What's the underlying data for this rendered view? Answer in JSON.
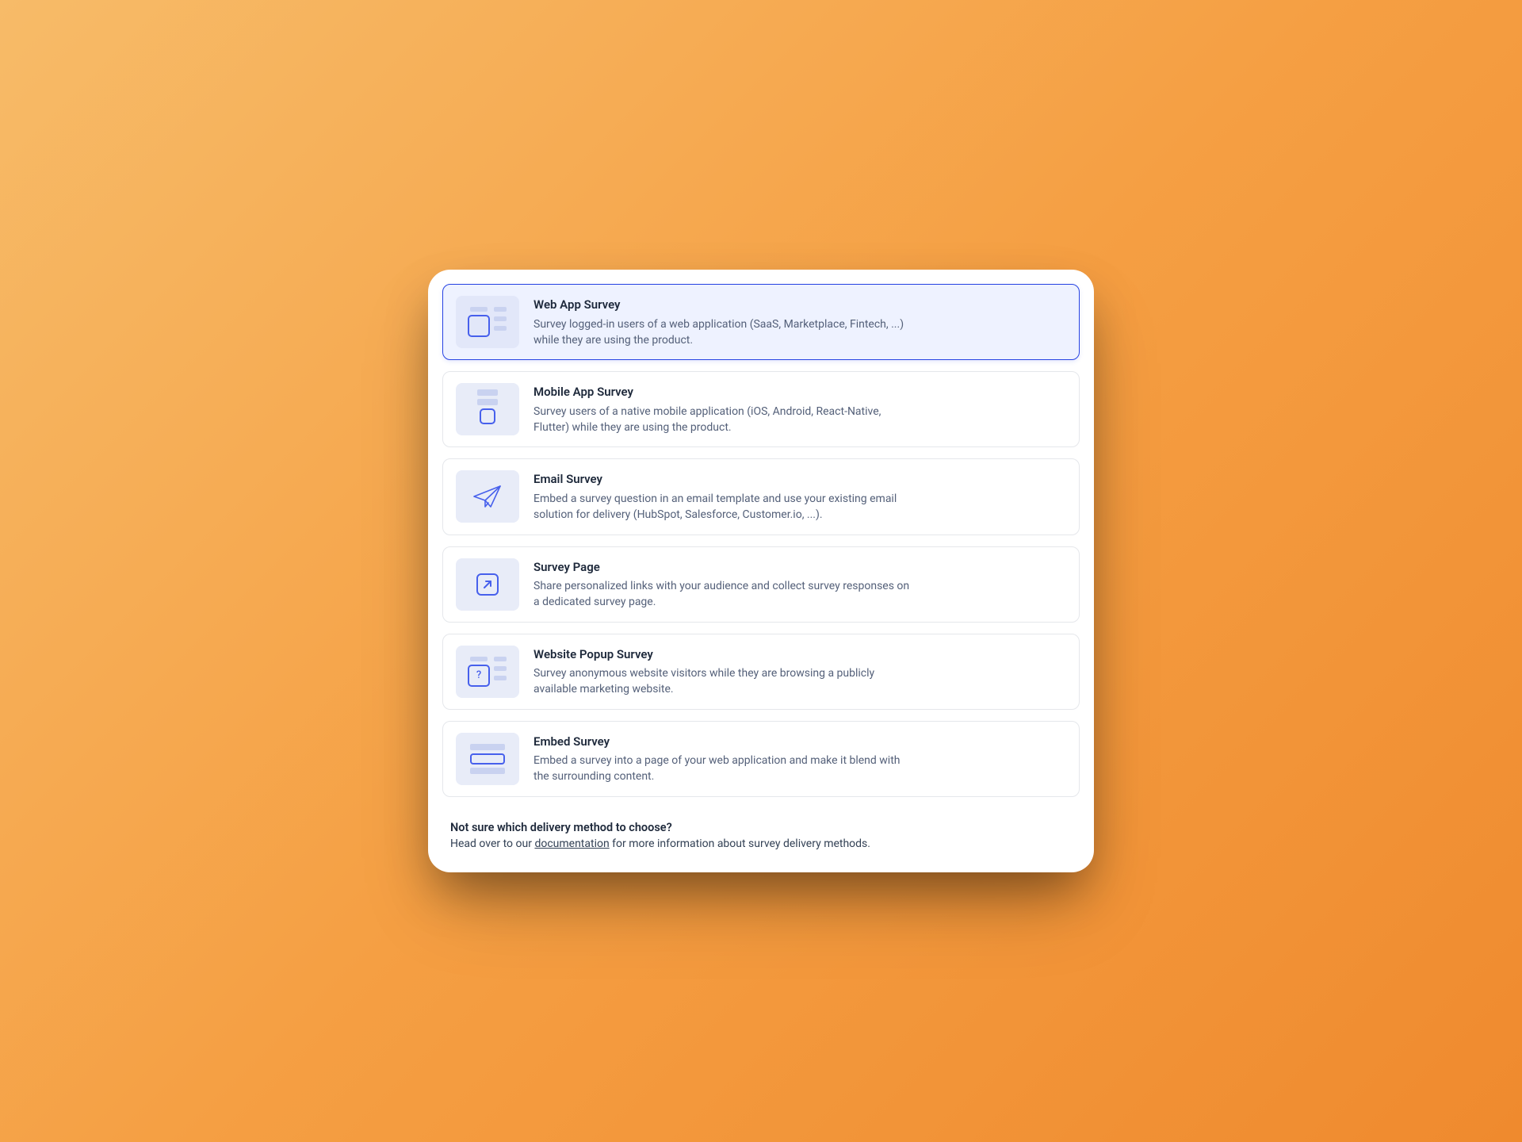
{
  "options": [
    {
      "id": "web-app",
      "title": "Web App Survey",
      "description": "Survey logged-in users of a web application (SaaS, Marketplace, Fintech, ...) while they are using the product.",
      "selected": true
    },
    {
      "id": "mobile-app",
      "title": "Mobile App Survey",
      "description": "Survey users of a native mobile application (iOS, Android, React-Native, Flutter) while they are using the product.",
      "selected": false
    },
    {
      "id": "email",
      "title": "Email Survey",
      "description": "Embed a survey question in an email template and use your existing email solution for delivery (HubSpot, Salesforce, Customer.io, ...).",
      "selected": false
    },
    {
      "id": "survey-page",
      "title": "Survey Page",
      "description": "Share personalized links with your audience and collect survey responses on a dedicated survey page.",
      "selected": false
    },
    {
      "id": "website-popup",
      "title": "Website Popup Survey",
      "description": "Survey anonymous website visitors while they are browsing a publicly available marketing website.",
      "selected": false
    },
    {
      "id": "embed",
      "title": "Embed Survey",
      "description": "Embed a survey into a page of your web application and make it blend with the surrounding content.",
      "selected": false
    }
  ],
  "footer": {
    "title": "Not sure which delivery method to choose?",
    "lead": "Head over to our ",
    "link": "documentation",
    "trail": " for more information about survey delivery methods."
  }
}
